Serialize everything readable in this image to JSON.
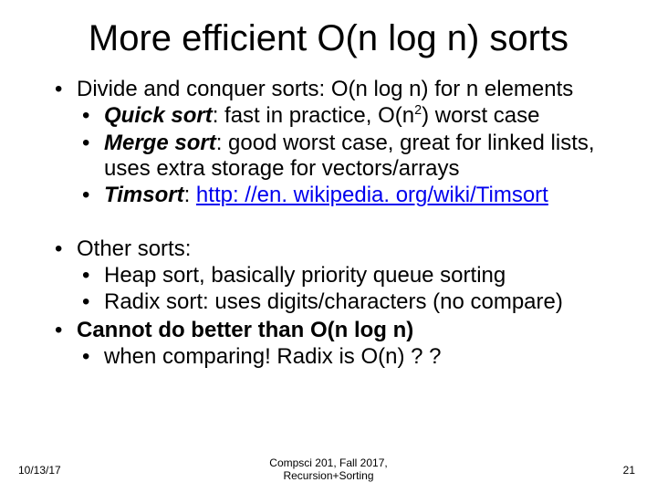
{
  "title": "More efficient O(n log n) sorts",
  "block1": {
    "header_pre": "Divide and conquer sorts: O(n log n) for n elements",
    "qs_label": "Quick sort",
    "qs_rest_a": ": fast in practice, O(n",
    "qs_sup": "2",
    "qs_rest_b": ") worst case",
    "ms_label": "Merge sort",
    "ms_rest": ": good worst case, great for linked lists, uses extra storage for vectors/arrays",
    "ts_label": "Timsort",
    "ts_colon": ": ",
    "ts_link": "http: //en. wikipedia. org/wiki/Timsort"
  },
  "block2": {
    "other": "Other sorts:",
    "heap": "Heap sort, basically priority queue sorting",
    "radix": "Radix sort: uses digits/characters (no compare)",
    "cannot": "Cannot do better than O(n log n)",
    "when": "when comparing! Radix is O(n) ? ?"
  },
  "footer": {
    "date": "10/13/17",
    "center": "Compsci 201, Fall 2017,\nRecursion+Sorting",
    "page": "21"
  }
}
